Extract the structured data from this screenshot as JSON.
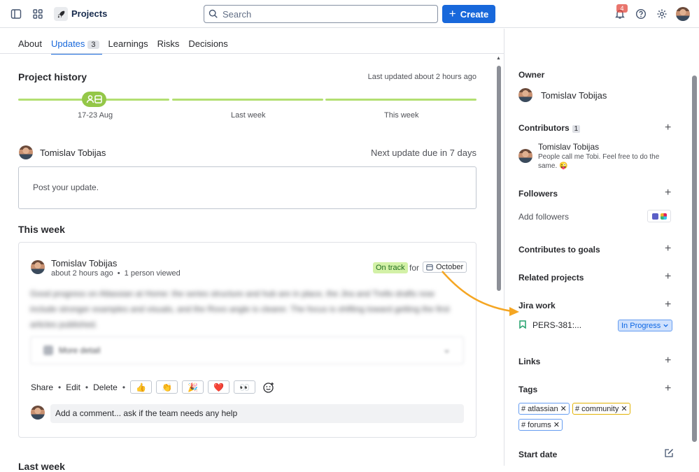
{
  "topbar": {
    "app_title": "Projects",
    "search_placeholder": "Search",
    "create_label": "Create",
    "notification_count": "4",
    "icons": [
      "sidebar-toggle-icon",
      "app-switcher-icon",
      "rocket-icon",
      "search-icon",
      "plus-icon",
      "bell-icon",
      "help-icon",
      "gear-icon"
    ]
  },
  "tabs": [
    {
      "label": "About"
    },
    {
      "label": "Updates",
      "count": "3",
      "active": true
    },
    {
      "label": "Learnings"
    },
    {
      "label": "Risks"
    },
    {
      "label": "Decisions"
    }
  ],
  "history": {
    "title": "Project history",
    "last_updated": "Last updated about 2 hours ago",
    "segments": [
      "17-23 Aug",
      "Last week",
      "This week"
    ]
  },
  "composer": {
    "author": "Tomislav Tobijas",
    "next_due": "Next update due in 7 days",
    "placeholder": "Post your update."
  },
  "this_week": {
    "title": "This week",
    "update": {
      "author": "Tomislav Tobijas",
      "meta": "about 2 hours ago",
      "viewed": "1 person viewed",
      "status": "On track",
      "for_label": "for",
      "target_date": "October",
      "body": "Good progress on Atlassian at Home: the series structure and hub are in place, the Jira and Trello drafts now include stronger examples and visuals, and the Rovo angle is clearer. The focus is shifting toward getting the first articles published.",
      "more_detail": "More detail",
      "actions": [
        "Share",
        "Edit",
        "Delete"
      ],
      "reactions": [
        "👍",
        "👏",
        "🎉",
        "❤️",
        "👀"
      ],
      "comment_placeholder": "Add a comment... ask if the team needs any help"
    }
  },
  "next_section_title": "Last week",
  "sidebar": {
    "owner": {
      "title": "Owner",
      "name": "Tomislav Tobijas"
    },
    "contributors": {
      "title": "Contributors",
      "count": "1",
      "name": "Tomislav Tobijas",
      "bio": "People call me Tobi. Feel free to do the same. 😜"
    },
    "followers": {
      "title": "Followers",
      "add_label": "Add followers"
    },
    "goals": {
      "title": "Contributes to goals"
    },
    "related": {
      "title": "Related projects"
    },
    "jira": {
      "title": "Jira work",
      "item_key": "PERS-381:...",
      "item_status": "In Progress"
    },
    "links": {
      "title": "Links"
    },
    "tags": {
      "title": "Tags",
      "items": [
        "# atlassian",
        "# community",
        "# forums"
      ]
    },
    "start_date": {
      "title": "Start date"
    }
  },
  "colors": {
    "brand_blue": "#1868db",
    "on_track_bg": "#d3f1a7",
    "timeline_green": "#b3df72",
    "annotation_arrow": "#f5a623"
  }
}
